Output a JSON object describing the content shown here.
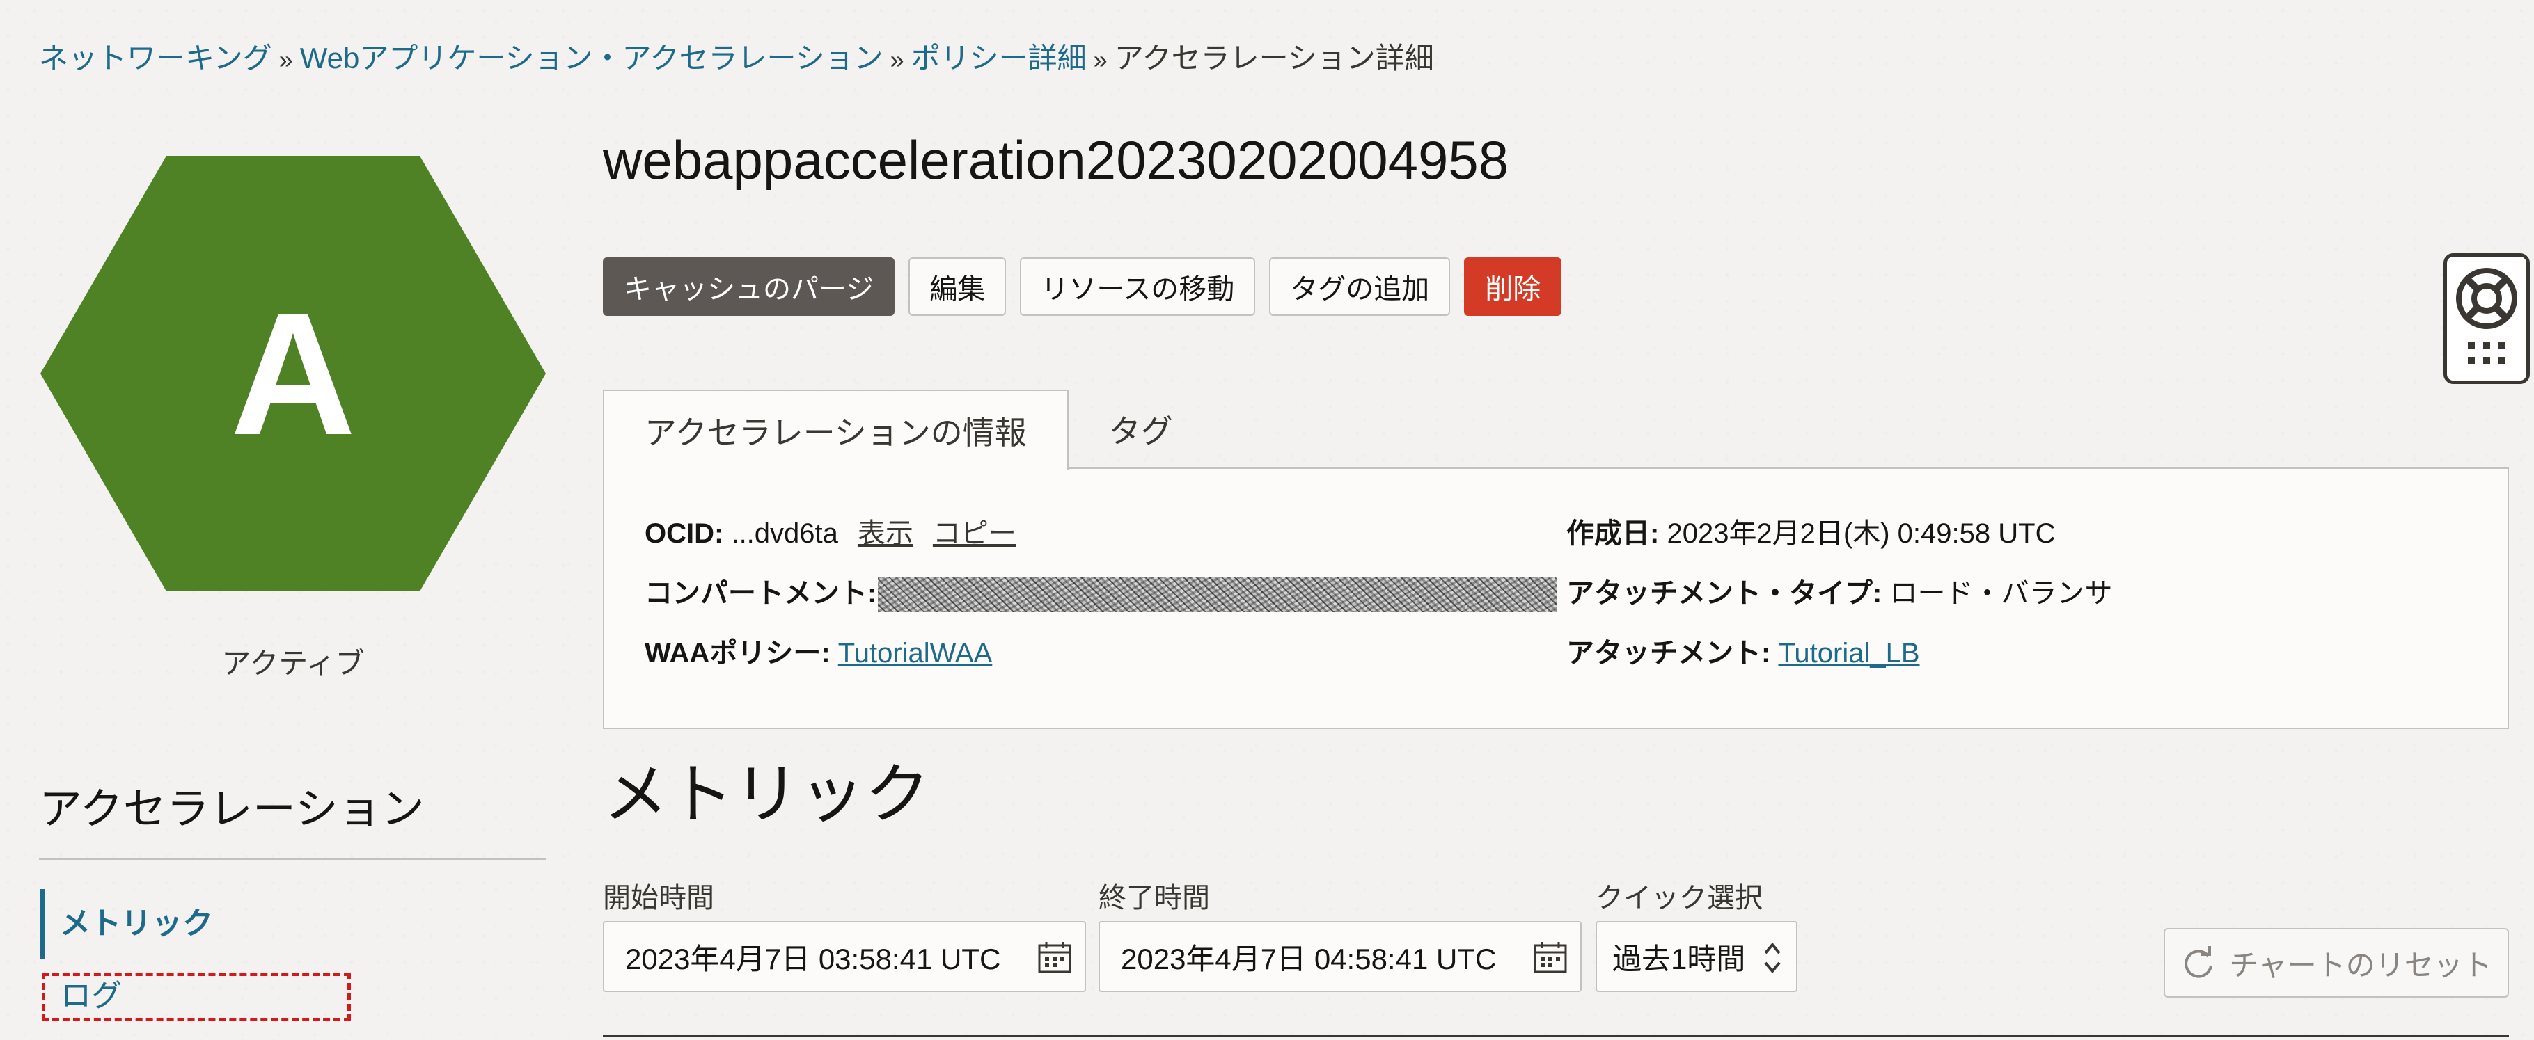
{
  "breadcrumb": {
    "items": [
      "ネットワーキング",
      "Webアプリケーション・アクセラレーション",
      "ポリシー詳細"
    ],
    "separator": "»",
    "current": "アクセラレーション詳細"
  },
  "resource": {
    "icon_letter": "A",
    "status": "アクティブ",
    "status_color": "#4f8125",
    "title": "webappacceleration20230202004958"
  },
  "toolbar": {
    "purge_label": "キャッシュのパージ",
    "edit_label": "編集",
    "move_label": "リソースの移動",
    "add_tag_label": "タグの追加",
    "delete_label": "削除"
  },
  "tabs": [
    "アクセラレーションの情報",
    "タグ"
  ],
  "info": {
    "ocid_key": "OCID:",
    "ocid_value": "...dvd6ta",
    "show_link": "表示",
    "copy_link": "コピー",
    "compartment_key": "コンパートメント:",
    "waa_policy_key": "WAAポリシー:",
    "waa_policy_value": "TutorialWAA",
    "created_key": "作成日:",
    "created_value": "2023年2月2日(木) 0:49:58 UTC",
    "attachment_type_key": "アタッチメント・タイプ:",
    "attachment_type_value": "ロード・バランサ",
    "attachment_key": "アタッチメント:",
    "attachment_value": "Tutorial_LB"
  },
  "nav": {
    "title": "アクセラレーション",
    "items": [
      "メトリック",
      "ログ"
    ]
  },
  "metrics": {
    "title": "メトリック",
    "start_label": "開始時間",
    "start_value": "2023年4月7日 03:58:41 UTC",
    "end_label": "終了時間",
    "end_value": "2023年4月7日 04:58:41 UTC",
    "quick_label": "クイック選択",
    "quick_value": "過去1時間",
    "reset_label": "チャートのリセット"
  },
  "icons": [
    "calendar-icon",
    "refresh-icon",
    "lifebuoy-icon",
    "apps-grid-icon",
    "updown-chevron-icon"
  ]
}
